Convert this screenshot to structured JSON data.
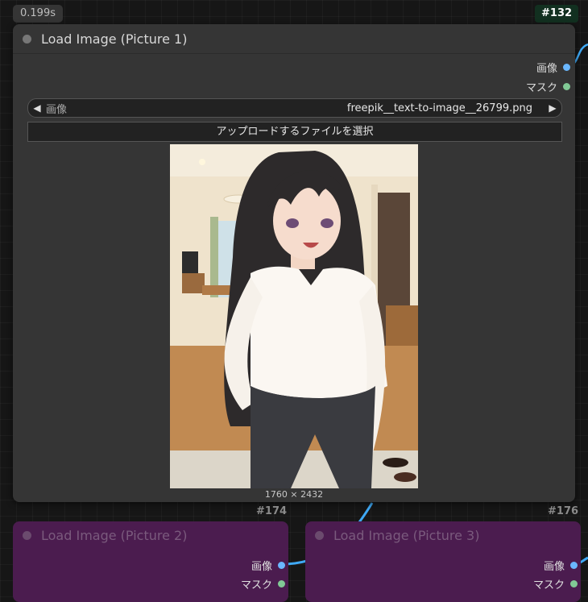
{
  "top_badge": {
    "time": "0.199s"
  },
  "main_node": {
    "id": "#132",
    "title": "Load Image (Picture 1)",
    "outputs": {
      "image_label": "画像",
      "mask_label": "マスク"
    },
    "combo": {
      "label": "画像",
      "value": "freepik__text-to-image__26799.png",
      "left_arrow": "◀",
      "right_arrow": "▶"
    },
    "upload_button": "アップロードするファイルを選択",
    "image_size": "1760 × 2432"
  },
  "node2": {
    "id": "#174",
    "title": "Load Image (Picture 2)",
    "outputs": {
      "image_label": "画像",
      "mask_label": "マスク"
    }
  },
  "node3": {
    "id": "#176",
    "title": "Load Image (Picture 3)",
    "outputs": {
      "image_label": "画像",
      "mask_label": "マスク"
    }
  },
  "colors": {
    "image_port": "#6ab7ff",
    "mask_port": "#81c995",
    "purple_node": "#4b1c4f",
    "node_bg": "#353535",
    "link": "#3fa9f5"
  }
}
